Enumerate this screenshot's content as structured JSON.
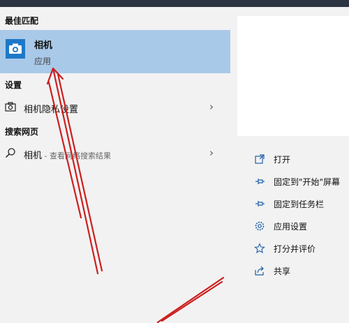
{
  "best_match": {
    "header": "最佳匹配",
    "app_name": "相机",
    "app_type": "应用"
  },
  "settings": {
    "header": "设置",
    "item_label": "相机隐私设置"
  },
  "web": {
    "header": "搜索网页",
    "item_label": "相机",
    "item_sub": " - 查看网络搜索结果"
  },
  "actions": [
    {
      "label": "打开",
      "icon": "open-icon"
    },
    {
      "label": "固定到\"开始\"屏幕",
      "icon": "pin-icon"
    },
    {
      "label": "固定到任务栏",
      "icon": "pin-icon"
    },
    {
      "label": "应用设置",
      "icon": "gear-icon"
    },
    {
      "label": "打分并评价",
      "icon": "star-icon"
    },
    {
      "label": "共享",
      "icon": "share-icon"
    }
  ],
  "colors": {
    "selected_bg": "#a9c9e8",
    "app_icon_bg": "#1e78c8",
    "arrow": "#cc1f1f"
  }
}
